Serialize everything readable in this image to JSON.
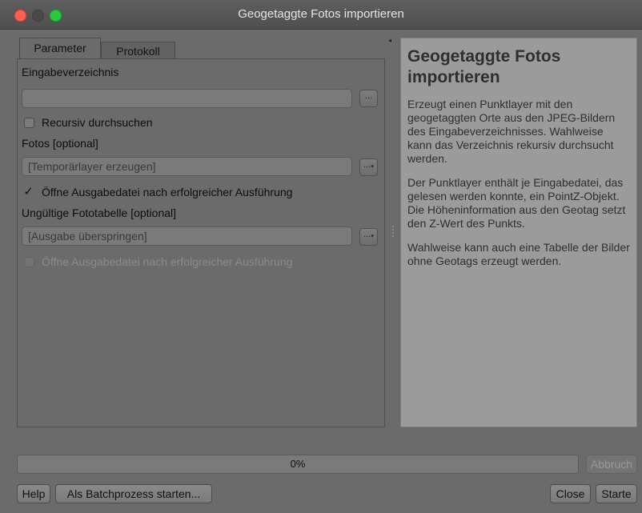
{
  "window": {
    "title": "Geogetaggte Fotos importieren"
  },
  "tabs": [
    {
      "label": "Parameter",
      "active": true
    },
    {
      "label": "Protokoll",
      "active": false
    }
  ],
  "params": {
    "input_dir_label": "Eingabeverzeichnis",
    "input_dir_value": "",
    "browse_label": "...",
    "recursive_label": "Recursiv durchsuchen",
    "recursive_checked": false,
    "photos_label": "Fotos [optional]",
    "photos_placeholder": "[Temporärlayer erzeugen]",
    "open_output_label": "Öffne Ausgabedatei nach erfolgreicher Ausführung",
    "open_output_checked": true,
    "invalid_label": "Ungültige Fototabelle [optional]",
    "invalid_placeholder": "[Ausgabe überspringen]",
    "open_output2_label": "Öffne Ausgabedatei nach erfolgreicher Ausführung",
    "open_output2_checked": false,
    "dropdown_arrow": "▾",
    "check_mark": "✓"
  },
  "help": {
    "title": "Geogetaggte Fotos importieren",
    "p1": "Erzeugt einen Punktlayer mit den geogetaggten Orte aus den JPEG-Bildern des Eingabeverzeichnisses. Wahlweise kann das Verzeichnis rekursiv durchsucht werden.",
    "p2": "Der Punktlayer enthält je Eingabedatei, das gelesen werden konnte, ein PointZ-Objekt. Die Höheninformation aus den Geotag setzt den Z-Wert des Punkts.",
    "p3": "Wahlweise kann auch eine Tabelle der Bilder ohne Geotags erzeugt werden."
  },
  "progress": {
    "text": "0%",
    "value": 0
  },
  "buttons": {
    "abort": "Abbruch",
    "help": "Help",
    "batch": "Als Batchprozess starten...",
    "close": "Close",
    "start": "Starte"
  },
  "icons": {
    "collapse": "◂"
  },
  "colors": {
    "close_light": "#ff5f57",
    "max_light": "#28c840"
  }
}
